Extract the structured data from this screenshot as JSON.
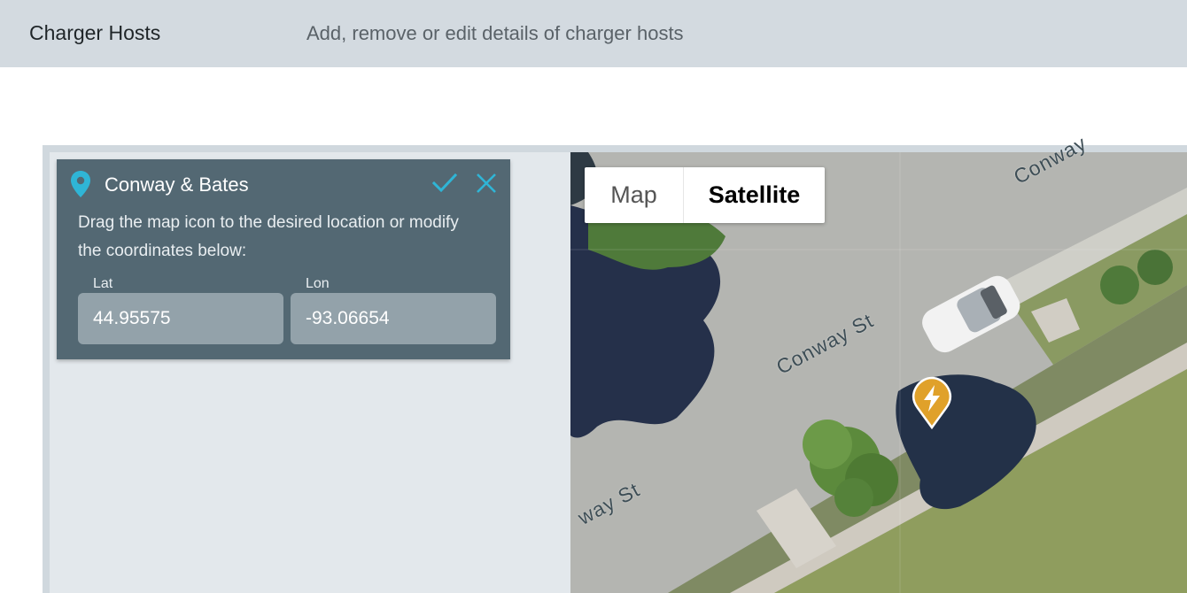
{
  "header": {
    "title": "Charger Hosts",
    "subtitle": "Add, remove or edit details of charger hosts"
  },
  "editor": {
    "location_name": "Conway & Bates",
    "instructions": "Drag the map icon to the desired location or modify the coordinates below:",
    "lat_label": "Lat",
    "lat_value": "44.95575",
    "lon_label": "Lon",
    "lon_value": "-93.06654",
    "confirm_icon": "check-icon",
    "close_icon": "close-icon",
    "accent_color": "#2fb5d6"
  },
  "map": {
    "type_options": [
      "Map",
      "Satellite"
    ],
    "map_label": "Map",
    "satellite_label": "Satellite",
    "selected_type": "Satellite",
    "street_labels": {
      "upper": "Conway",
      "middle": "Conway St",
      "lower": "way St"
    },
    "marker_icon": "lightning-bolt-icon",
    "marker_color": "#e0a12a"
  }
}
